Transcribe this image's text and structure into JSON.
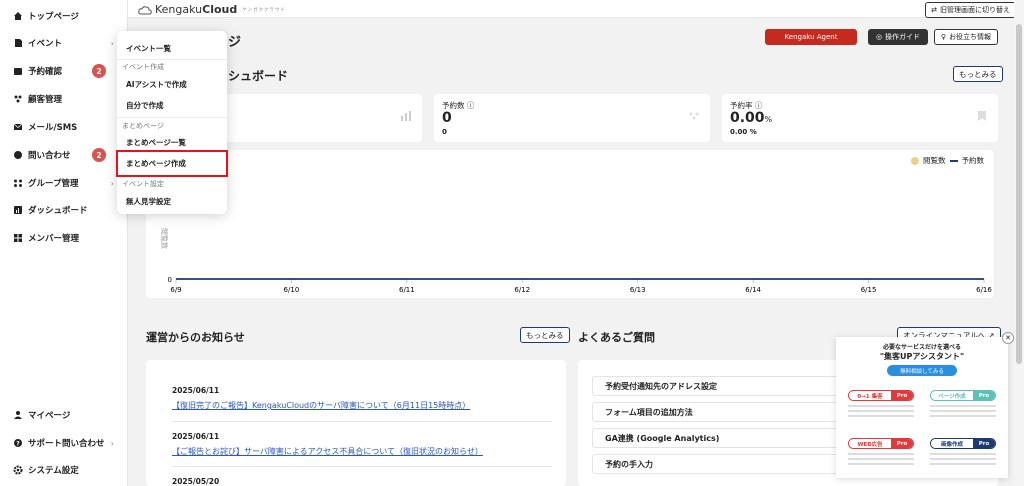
{
  "sidebar": {
    "items": [
      {
        "label": "トップページ"
      },
      {
        "label": "イベント"
      },
      {
        "label": "予約確認",
        "badge": "2"
      },
      {
        "label": "顧客管理"
      },
      {
        "label": "メール/SMS"
      },
      {
        "label": "問い合わせ",
        "badge": "2"
      },
      {
        "label": "グループ管理"
      },
      {
        "label": "ダッシュボード"
      },
      {
        "label": "メンバー管理"
      }
    ],
    "bottom": [
      {
        "label": "マイページ"
      },
      {
        "label": "サポート問い合わせ"
      },
      {
        "label": "システム設定"
      }
    ]
  },
  "topbar": {
    "logo_main": "Kengaku",
    "logo_bold": "Cloud",
    "logo_sub": "ケンガククラウド",
    "legacy_button": "旧管理画面に切り替え"
  },
  "header": {
    "title_fragment": "ジ",
    "agent_button": "Kengaku Agent",
    "guide_button": "操作ガイド",
    "help_button": "お役立ち情報"
  },
  "dashboard": {
    "title_fragment": "シュボード",
    "more_button": "もっとみる",
    "cards": [
      {
        "label": "予約数",
        "value": "0",
        "sub": "0"
      },
      {
        "label": "予約率",
        "value": "0.00",
        "unit": "%",
        "sub": "0.00 %"
      }
    ]
  },
  "chart_data": {
    "type": "line",
    "series": [
      {
        "name": "閲覧数",
        "values": [
          0,
          0,
          0,
          0,
          0,
          0,
          0,
          0
        ]
      },
      {
        "name": "予約数",
        "values": [
          0,
          0,
          0,
          0,
          0,
          0,
          0,
          0
        ]
      }
    ],
    "x": [
      "6/9",
      "6/10",
      "6/11",
      "6/12",
      "6/13",
      "6/14",
      "6/15",
      "6/16"
    ],
    "y_ticks": [
      "0"
    ],
    "ylabel": "閲覧数",
    "legend_placement": "top-right",
    "colors": {
      "views": "#e8d28f",
      "reservations": "#1e3a6e"
    }
  },
  "news": {
    "title": "運営からのお知らせ",
    "more_button": "もっとみる",
    "items": [
      {
        "date": "2025/06/11",
        "text": "【復旧完了のご報告】KengakuCloudのサーバ障害について（6月11日15時時点）"
      },
      {
        "date": "2025/06/11",
        "text": "【ご報告とお詫び】サーバ障害によるアクセス不具合について（復旧状況のお知らせ）"
      },
      {
        "date": "2025/05/20",
        "text": ""
      }
    ]
  },
  "faq": {
    "title": "よくあるご質問",
    "manual_button": "オンラインマニュアルへ",
    "items": [
      "予約受付通知先のアドレス設定",
      "フォーム項目の追加方法",
      "GA連携 (Google Analytics)",
      "予約の手入力"
    ]
  },
  "dropdown": {
    "items": [
      {
        "type": "item",
        "label": "イベント一覧"
      },
      {
        "type": "section",
        "label": "イベント作成"
      },
      {
        "type": "item",
        "label": "AIアシストで作成"
      },
      {
        "type": "item",
        "label": "自分で作成"
      },
      {
        "type": "section",
        "label": "まとめページ"
      },
      {
        "type": "item",
        "label": "まとめページ一覧"
      },
      {
        "type": "item",
        "label": "まとめページ作成"
      },
      {
        "type": "section",
        "label": "イベント設定"
      },
      {
        "type": "item",
        "label": "無人見学設定"
      }
    ]
  },
  "ad": {
    "line1": "必要なサービスだけを選べる",
    "line2": "\"集客UPアシスタント\"",
    "cta": "無料相談してみる",
    "tiles": [
      {
        "left": "0→1 集客",
        "right": "Pro",
        "color": "#e23a3a"
      },
      {
        "left": "ページ作成",
        "right": "Pro",
        "color": "#5fc0b5"
      },
      {
        "left": "WEB広告",
        "right": "Pro",
        "color": "#e23a3a"
      },
      {
        "left": "画像作成",
        "right": "Pro",
        "color": "#1e3a6e"
      }
    ]
  }
}
